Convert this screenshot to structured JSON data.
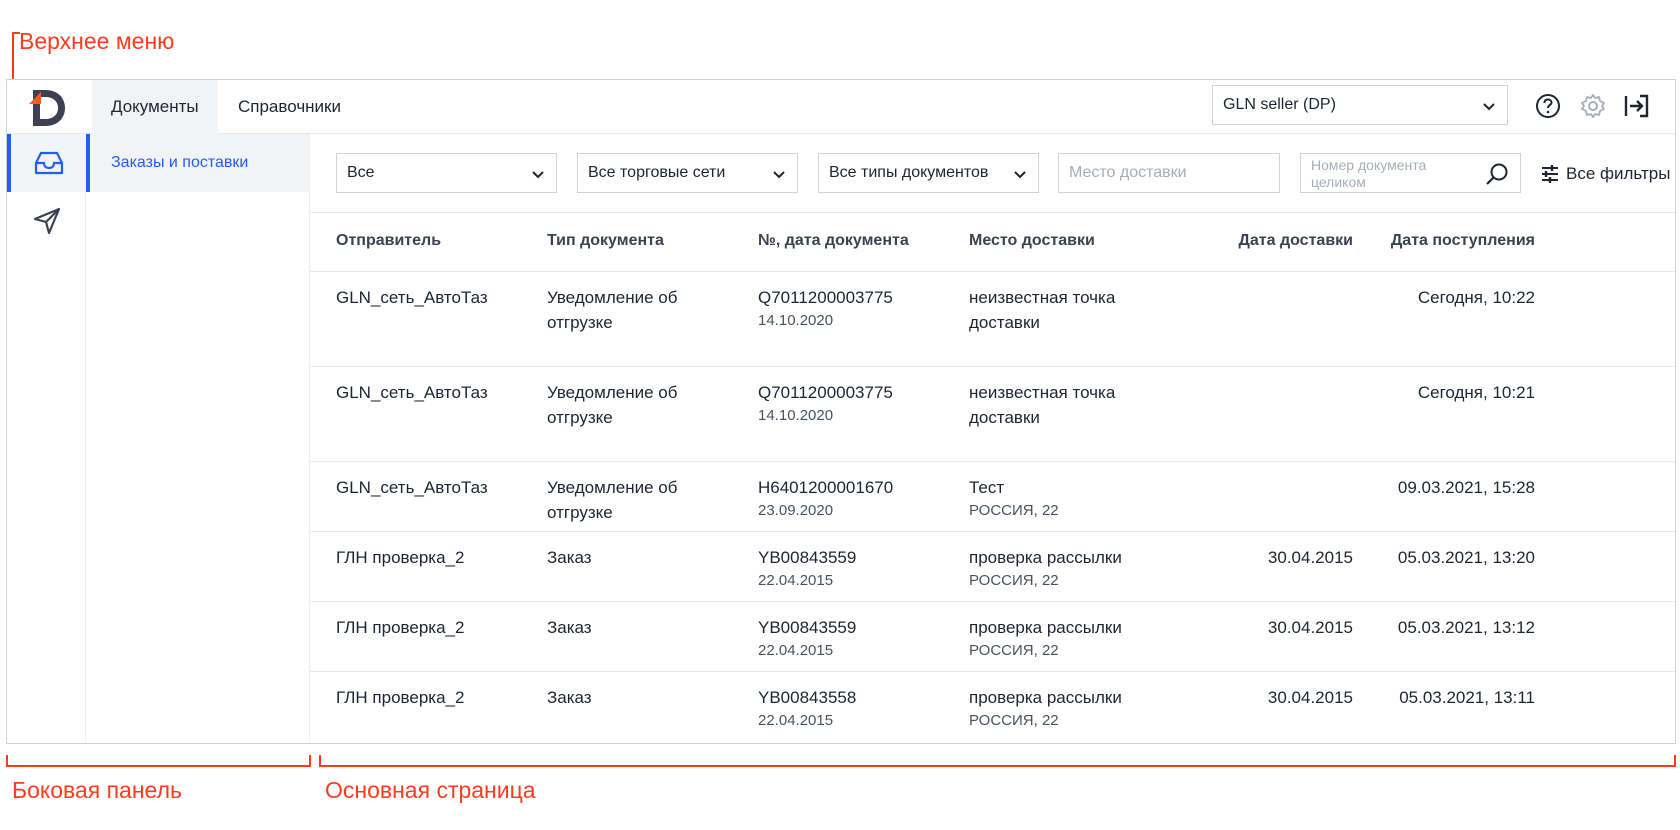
{
  "annotations": {
    "top_menu": "Верхнее меню",
    "sidebar": "Боковая панель",
    "main_page": "Основная страница"
  },
  "colors": {
    "accent": "#1f5ff2",
    "annotation": "#ff3b1f",
    "logo_orange": "#ff5a1f",
    "logo_dark": "#3b4150"
  },
  "topbar": {
    "logo": "d-logo-icon",
    "tabs": [
      {
        "label": "Документы",
        "active": true
      },
      {
        "label": "Справочники",
        "active": false
      }
    ],
    "gln_select": "GLN seller (DP)",
    "icons": [
      "help-icon",
      "gear-icon",
      "logout-icon"
    ]
  },
  "sidebar": {
    "rail": [
      {
        "icon": "inbox-icon",
        "active": true
      },
      {
        "icon": "send-icon",
        "active": false
      }
    ],
    "subnav": [
      {
        "label": "Заказы и поставки",
        "active": true
      }
    ]
  },
  "filters": {
    "status": "Все",
    "retail_networks": "Все торговые сети",
    "doc_types": "Все типы документов",
    "delivery_place_placeholder": "Место доставки",
    "doc_number_placeholder": "Номер документа целиком",
    "all_filters": "Все фильтры"
  },
  "table": {
    "headers": {
      "sender": "Отправитель",
      "doc_type": "Тип документа",
      "doc_number_date": "№, дата документа",
      "delivery_place": "Место доставки",
      "delivery_date": "Дата доставки",
      "received_date": "Дата поступления"
    },
    "rows": [
      {
        "sender": "GLN_сеть_АвтоТаз",
        "doc_type": "Уведомление об отгрузке",
        "doc_number": "Q7011200003775",
        "doc_date": "14.10.2020",
        "place": "неизвестная точка доставки",
        "place_sub": "",
        "delivery_date": "",
        "received": "Сегодня, 10:22"
      },
      {
        "sender": "GLN_сеть_АвтоТаз",
        "doc_type": "Уведомление об отгрузке",
        "doc_number": "Q7011200003775",
        "doc_date": "14.10.2020",
        "place": "неизвестная точка доставки",
        "place_sub": "",
        "delivery_date": "",
        "received": "Сегодня, 10:21"
      },
      {
        "sender": "GLN_сеть_АвтоТаз",
        "doc_type": "Уведомление об отгрузке",
        "doc_number": "H6401200001670",
        "doc_date": "23.09.2020",
        "place": "Тест",
        "place_sub": "РОССИЯ, 22",
        "delivery_date": "",
        "received": "09.03.2021, 15:28"
      },
      {
        "sender": "ГЛН проверка_2",
        "doc_type": "Заказ",
        "doc_number": "YB00843559",
        "doc_date": "22.04.2015",
        "place": "проверка рассылки",
        "place_sub": "РОССИЯ, 22",
        "delivery_date": "30.04.2015",
        "received": "05.03.2021, 13:20"
      },
      {
        "sender": "ГЛН проверка_2",
        "doc_type": "Заказ",
        "doc_number": "YB00843559",
        "doc_date": "22.04.2015",
        "place": "проверка рассылки",
        "place_sub": "РОССИЯ, 22",
        "delivery_date": "30.04.2015",
        "received": "05.03.2021, 13:12"
      },
      {
        "sender": "ГЛН проверка_2",
        "doc_type": "Заказ",
        "doc_number": "YB00843558",
        "doc_date": "22.04.2015",
        "place": "проверка рассылки",
        "place_sub": "РОССИЯ, 22",
        "delivery_date": "30.04.2015",
        "received": "05.03.2021, 13:11"
      }
    ]
  }
}
